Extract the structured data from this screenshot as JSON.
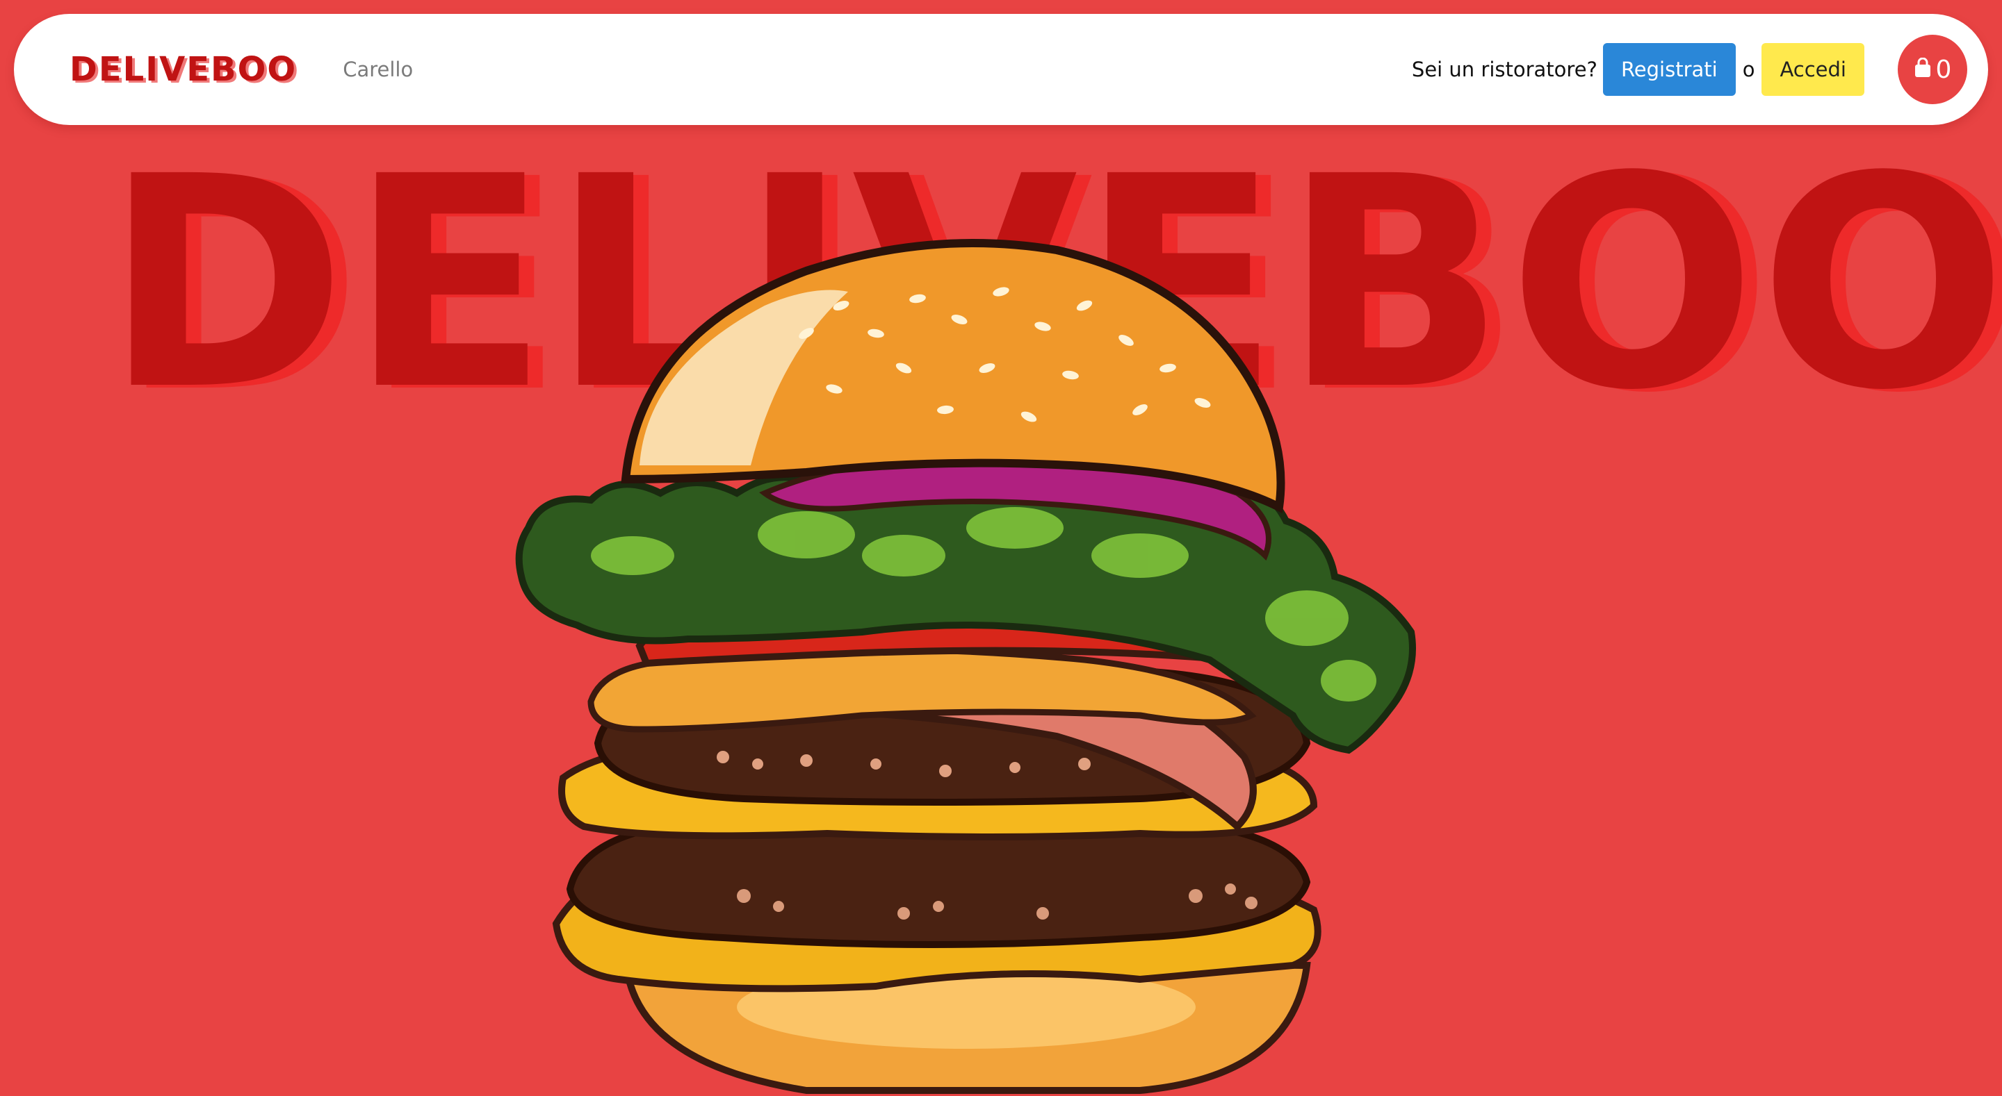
{
  "navbar": {
    "brand": "DELIVEBOO",
    "cart_link": "Carello",
    "restaurant_question": "Sei un ristoratore?",
    "register_label": "Registrati",
    "or_text": "o",
    "login_label": "Accedi",
    "cart_count": "0",
    "cart_icon": "shopping-bag-icon"
  },
  "hero": {
    "title": "DELIVEBOO",
    "image": "burger-illustration"
  },
  "colors": {
    "background": "#e84343",
    "brand_red": "#c01313",
    "register_blue": "#2a87d8",
    "login_yellow": "#ffe94d"
  }
}
